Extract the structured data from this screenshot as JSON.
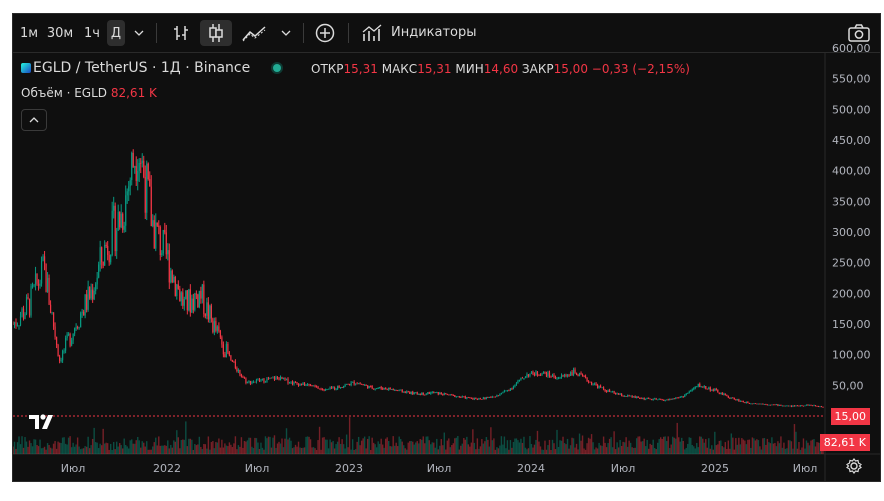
{
  "toolbar": {
    "intervals": [
      "1м",
      "30м",
      "1ч",
      "Д"
    ],
    "indicators_label": "Индикаторы"
  },
  "legend": {
    "symbol": "EGLD / TetherUS · 1Д · Binance",
    "open_label": "ОТКР",
    "open": "15,31",
    "high_label": "МАКС",
    "high": "15,31",
    "low_label": "МИН",
    "low": "14,60",
    "close_label": "ЗАКР",
    "close": "15,00",
    "change": "−0,33 (−2,15%)"
  },
  "volume_legend": {
    "label": "Объём · EGLD",
    "value": "82,61 K"
  },
  "price_tag": "15,00",
  "volume_tag": "82,61 K",
  "colors": {
    "up": "#089981",
    "down": "#f23645",
    "background": "#0f0f0f"
  },
  "chart_data": {
    "type": "line",
    "title": "EGLD / TetherUS · 1Д · Binance",
    "y_ticks": [
      "600,00",
      "550,00",
      "500,00",
      "450,00",
      "400,00",
      "350,00",
      "300,00",
      "250,00",
      "200,00",
      "150,00",
      "100,00",
      "50,00"
    ],
    "y_range": [
      0,
      600
    ],
    "x_ticks": [
      "Июл",
      "2022",
      "Июл",
      "2023",
      "Июл",
      "2024",
      "Июл",
      "2025",
      "Июл"
    ],
    "x": [
      "2021-04",
      "2021-05",
      "2021-06",
      "2021-07",
      "2021-08",
      "2021-09",
      "2021-10",
      "2021-11",
      "2021-12",
      "2022-01",
      "2022-02",
      "2022-03",
      "2022-04",
      "2022-05",
      "2022-06",
      "2022-07",
      "2022-08",
      "2022-09",
      "2022-10",
      "2022-11",
      "2022-12",
      "2023-01",
      "2023-02",
      "2023-03",
      "2023-04",
      "2023-05",
      "2023-06",
      "2023-07",
      "2023-08",
      "2023-09",
      "2023-10",
      "2023-11",
      "2023-12",
      "2024-01",
      "2024-02",
      "2024-03",
      "2024-04",
      "2024-05",
      "2024-06",
      "2024-07",
      "2024-08",
      "2024-09",
      "2024-10",
      "2024-11",
      "2024-12",
      "2025-01",
      "2025-02",
      "2025-03",
      "2025-04",
      "2025-05",
      "2025-06",
      "2025-07",
      "2025-08"
    ],
    "series": [
      {
        "values": [
          150,
          180,
          240,
          90,
          150,
          200,
          280,
          330,
          450,
          310,
          250,
          180,
          200,
          140,
          90,
          55,
          58,
          62,
          54,
          50,
          42,
          48,
          55,
          46,
          45,
          40,
          36,
          38,
          34,
          30,
          28,
          32,
          46,
          68,
          70,
          62,
          72,
          56,
          42,
          34,
          30,
          27,
          26,
          32,
          50,
          42,
          30,
          22,
          20,
          18,
          16,
          18,
          15
        ]
      }
    ]
  }
}
